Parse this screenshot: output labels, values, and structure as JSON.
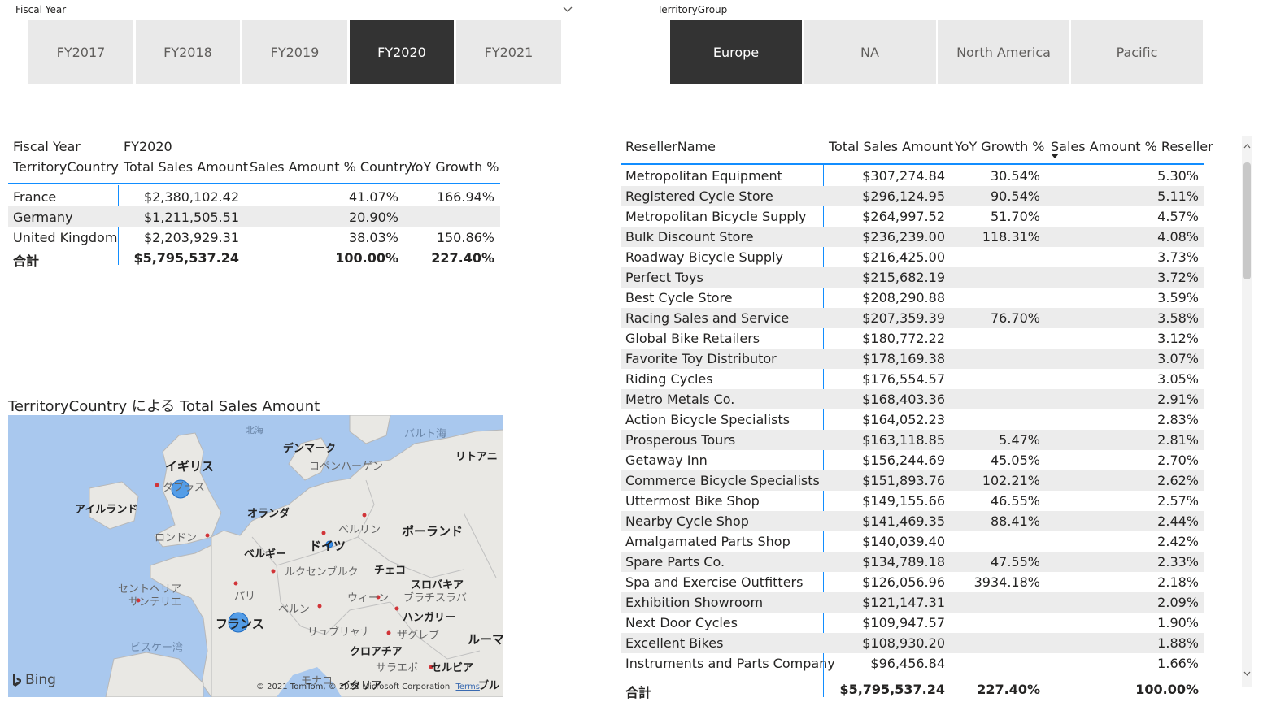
{
  "fiscal_year_slicer": {
    "title": "Fiscal Year",
    "options": [
      "FY2017",
      "FY2018",
      "FY2019",
      "FY2020",
      "FY2021"
    ],
    "selected": "FY2020"
  },
  "territory_slicer": {
    "title": "TerritoryGroup",
    "options": [
      "Europe",
      "NA",
      "North America",
      "Pacific"
    ],
    "selected": "Europe"
  },
  "country_matrix": {
    "col_header_label": "Fiscal Year",
    "col_header_value": "FY2020",
    "row_header": "TerritoryCountry",
    "measures": [
      "Total Sales Amount",
      "Sales Amount % Country",
      "YoY Growth %"
    ],
    "rows": [
      {
        "country": "France",
        "total": "$2,380,102.42",
        "pct": "41.07%",
        "yoy": "166.94%"
      },
      {
        "country": "Germany",
        "total": "$1,211,505.51",
        "pct": "20.90%",
        "yoy": ""
      },
      {
        "country": "United Kingdom",
        "total": "$2,203,929.31",
        "pct": "38.03%",
        "yoy": "150.86%"
      }
    ],
    "total": {
      "label": "合計",
      "total": "$5,795,537.24",
      "pct": "100.00%",
      "yoy": "227.40%"
    }
  },
  "reseller_table": {
    "columns": [
      "ResellerName",
      "Total Sales Amount",
      "YoY Growth %",
      "Sales Amount % Reseller"
    ],
    "rows": [
      {
        "name": "Metropolitan Equipment",
        "total": "$307,274.84",
        "yoy": "30.54%",
        "pct": "5.30%"
      },
      {
        "name": "Registered Cycle Store",
        "total": "$296,124.95",
        "yoy": "90.54%",
        "pct": "5.11%"
      },
      {
        "name": "Metropolitan Bicycle Supply",
        "total": "$264,997.52",
        "yoy": "51.70%",
        "pct": "4.57%"
      },
      {
        "name": "Bulk Discount Store",
        "total": "$236,239.00",
        "yoy": "118.31%",
        "pct": "4.08%"
      },
      {
        "name": "Roadway Bicycle Supply",
        "total": "$216,425.00",
        "yoy": "",
        "pct": "3.73%"
      },
      {
        "name": "Perfect Toys",
        "total": "$215,682.19",
        "yoy": "",
        "pct": "3.72%"
      },
      {
        "name": "Best Cycle Store",
        "total": "$208,290.88",
        "yoy": "",
        "pct": "3.59%"
      },
      {
        "name": "Racing Sales and Service",
        "total": "$207,359.39",
        "yoy": "76.70%",
        "pct": "3.58%"
      },
      {
        "name": "Global Bike Retailers",
        "total": "$180,772.22",
        "yoy": "",
        "pct": "3.12%"
      },
      {
        "name": "Favorite Toy Distributor",
        "total": "$178,169.38",
        "yoy": "",
        "pct": "3.07%"
      },
      {
        "name": "Riding Cycles",
        "total": "$176,554.57",
        "yoy": "",
        "pct": "3.05%"
      },
      {
        "name": "Metro Metals Co.",
        "total": "$168,403.36",
        "yoy": "",
        "pct": "2.91%"
      },
      {
        "name": "Action Bicycle Specialists",
        "total": "$164,052.23",
        "yoy": "",
        "pct": "2.83%"
      },
      {
        "name": "Prosperous Tours",
        "total": "$163,118.85",
        "yoy": "5.47%",
        "pct": "2.81%"
      },
      {
        "name": "Getaway Inn",
        "total": "$156,244.69",
        "yoy": "45.05%",
        "pct": "2.70%"
      },
      {
        "name": "Commerce Bicycle Specialists",
        "total": "$151,893.76",
        "yoy": "102.21%",
        "pct": "2.62%"
      },
      {
        "name": "Uttermost Bike Shop",
        "total": "$149,155.66",
        "yoy": "46.55%",
        "pct": "2.57%"
      },
      {
        "name": "Nearby Cycle Shop",
        "total": "$141,469.35",
        "yoy": "88.41%",
        "pct": "2.44%"
      },
      {
        "name": "Amalgamated Parts Shop",
        "total": "$140,039.40",
        "yoy": "",
        "pct": "2.42%"
      },
      {
        "name": "Spare Parts Co.",
        "total": "$134,789.18",
        "yoy": "47.55%",
        "pct": "2.33%"
      },
      {
        "name": "Spa and Exercise Outfitters",
        "total": "$126,056.96",
        "yoy": "3934.18%",
        "pct": "2.18%"
      },
      {
        "name": "Exhibition Showroom",
        "total": "$121,147.31",
        "yoy": "",
        "pct": "2.09%"
      },
      {
        "name": "Next Door Cycles",
        "total": "$109,947.57",
        "yoy": "",
        "pct": "1.90%"
      },
      {
        "name": "Excellent Bikes",
        "total": "$108,930.20",
        "yoy": "",
        "pct": "1.88%"
      },
      {
        "name": "Instruments and Parts Company",
        "total": "$96,456.84",
        "yoy": "",
        "pct": "1.66%"
      }
    ],
    "total": {
      "label": "合計",
      "total": "$5,795,537.24",
      "yoy": "227.40%",
      "pct": "100.00%"
    }
  },
  "map_visual": {
    "title": "TerritoryCountry による Total Sales Amount",
    "labels": {
      "hokkai": "北海",
      "baltic": "バルト海",
      "denmark": "デンマーク",
      "lithuania": "リトアニ",
      "copenhagen": "コペンハーゲン",
      "uk": "イギリス",
      "dublin": "ダブラス",
      "ireland": "アイルランド",
      "netherlands": "オランダ",
      "berlin": "ベルリン",
      "poland": "ポーランド",
      "london": "ロンドン",
      "germany": "ドイツ",
      "belgium": "ベルギー",
      "luxembourg": "ルクセンブルク",
      "czech": "チェコ",
      "paris": "パリ",
      "slovakia": "スロバキア",
      "vienna": "ウィーン",
      "bratislava": "ブラチスラバ",
      "st_helier": "セントヘリア",
      "st_helier2": "サンテリエ",
      "bern": "ベルン",
      "hungary": "ハンガリー",
      "france": "フランス",
      "ljubljana": "リュブリャナ",
      "zagreb": "ザグレブ",
      "romania": "ルーマ",
      "biscay": "ビスケー湾",
      "croatia": "クロアチア",
      "sarajevo": "サラエボ",
      "serbia": "セルビア",
      "monaco": "モナコ",
      "italy": "イタリア",
      "bulgaria": "ブル"
    },
    "copyright": "© 2021 TomTom, © 2021 Microsoft Corporation",
    "terms": "Terms",
    "brand": "Bing"
  },
  "colors": {
    "selected_tile": "#333333",
    "tile": "#e9e9e9",
    "accent_line": "#118dff",
    "bubble": "#3a8fe8",
    "band": "#ececec"
  }
}
